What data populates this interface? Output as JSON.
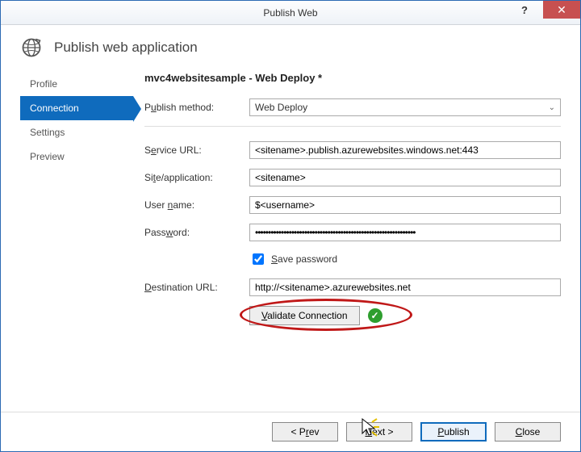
{
  "window": {
    "title": "Publish Web"
  },
  "header": {
    "text": "Publish web application"
  },
  "sidebar": {
    "items": [
      {
        "label": "Profile"
      },
      {
        "label": "Connection"
      },
      {
        "label": "Settings"
      },
      {
        "label": "Preview"
      }
    ],
    "active_index": 1
  },
  "main": {
    "title": "mvc4websitesample - Web Deploy *",
    "publish_method_label": "Publish method:",
    "publish_method_value": "Web Deploy",
    "service_url_label": "Service URL:",
    "service_url_value": "<sitename>.publish.azurewebsites.windows.net:443",
    "site_app_label": "Site/application:",
    "site_app_value": "<sitename>",
    "username_label": "User name:",
    "username_value": "$<username>",
    "password_label": "Password:",
    "password_value": "••••••••••••••••••••••••••••••••••••••••••••••••••••••••••••••",
    "save_password_label": "Save password",
    "save_password_checked": true,
    "dest_url_label": "Destination URL:",
    "dest_url_value": "http://<sitename>.azurewebsites.net",
    "validate_label": "Validate Connection",
    "validated_ok": true
  },
  "footer": {
    "prev": "< Prev",
    "next": "Next >",
    "publish": "Publish",
    "close": "Close"
  }
}
